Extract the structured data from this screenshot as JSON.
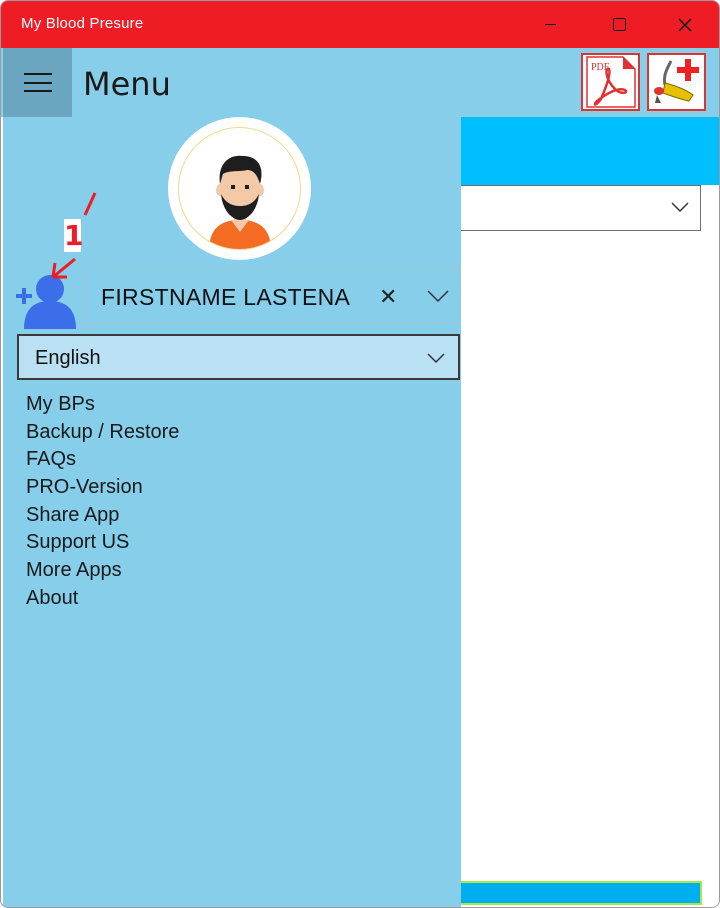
{
  "window": {
    "title": "My Blood Presure"
  },
  "header": {
    "menu_label": "Menu",
    "pdf_text": "PDF"
  },
  "user": {
    "name": "FIRSTNAME LASTENA"
  },
  "language": {
    "selected": "English"
  },
  "menu": {
    "items": [
      {
        "label": "My BPs"
      },
      {
        "label": "Backup / Restore"
      },
      {
        "label": "FAQs"
      },
      {
        "label": "PRO-Version"
      },
      {
        "label": "Share App"
      },
      {
        "label": "Support US"
      },
      {
        "label": "More Apps"
      },
      {
        "label": "About"
      }
    ]
  },
  "annotation": {
    "number": "1"
  },
  "colors": {
    "titlebar": "#ee1c25",
    "panel": "#87ceeb",
    "hamburger_bg": "#6aa6bf",
    "accent_blue": "#00bfff",
    "add_user_icon": "#3b6ee8",
    "annotation": "#ee1c25"
  }
}
